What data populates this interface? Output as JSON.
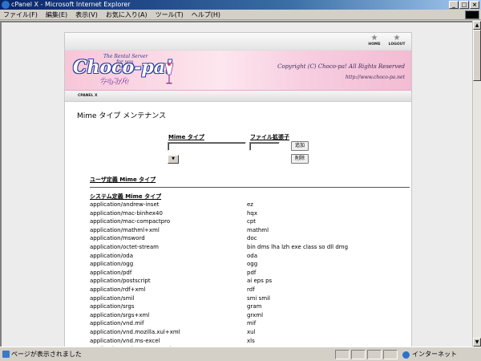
{
  "window": {
    "title": "cPanel X - Microsoft Internet Explorer",
    "buttons": [
      "_",
      "□",
      "×"
    ]
  },
  "menubar": {
    "items": [
      "ファイル(F)",
      "編集(E)",
      "表示(V)",
      "お気に入り(A)",
      "ツール(T)",
      "ヘルプ(H)"
    ]
  },
  "topnav": {
    "home_label": "HOME",
    "logout_label": "LOGOUT"
  },
  "banner": {
    "tagline": "The Rental Server",
    "tagline2": "for you",
    "logo": "Choco-pa!",
    "logo_kana": "チョコパ!",
    "copyright": "Copyright (C) Choco-pa! All Rights Reserved",
    "url": "http://www.choco-pa.net"
  },
  "breadcrumb": {
    "label": "CPANEL X"
  },
  "page": {
    "title": "Mime タイプ メンテナンス"
  },
  "form": {
    "mime_header": "Mime タイプ",
    "ext_header": "ファイル拡張子",
    "mime_value": "",
    "ext_value": "",
    "add_button": "追加",
    "delete_button": "削除",
    "select_value": "▼"
  },
  "sections": {
    "user_defined": "ユーザ定義 Mime タイプ",
    "system_defined": "システム定義 Mime タイプ"
  },
  "mime_types": [
    {
      "type": "application/andrew-inset",
      "ext": "ez"
    },
    {
      "type": "application/mac-binhex40",
      "ext": "hqx"
    },
    {
      "type": "application/mac-compactpro",
      "ext": "cpt"
    },
    {
      "type": "application/mathml+xml",
      "ext": "mathml"
    },
    {
      "type": "application/msword",
      "ext": "doc"
    },
    {
      "type": "application/octet-stream",
      "ext": "bin dms lha lzh exe class so dll dmg"
    },
    {
      "type": "application/oda",
      "ext": "oda"
    },
    {
      "type": "application/ogg",
      "ext": "ogg"
    },
    {
      "type": "application/pdf",
      "ext": "pdf"
    },
    {
      "type": "application/postscript",
      "ext": "ai eps ps"
    },
    {
      "type": "application/rdf+xml",
      "ext": "rdf"
    },
    {
      "type": "application/smil",
      "ext": "smi smil"
    },
    {
      "type": "application/srgs",
      "ext": "gram"
    },
    {
      "type": "application/srgs+xml",
      "ext": "grxml"
    },
    {
      "type": "application/vnd.mif",
      "ext": "mif"
    },
    {
      "type": "application/vnd.mozilla.xul+xml",
      "ext": "xul"
    },
    {
      "type": "application/vnd.ms-excel",
      "ext": "xls"
    },
    {
      "type": "application/vnd.ms-powerpoint",
      "ext": "ppt"
    }
  ],
  "statusbar": {
    "text": "ページが表示されました",
    "zone": "インターネット"
  }
}
